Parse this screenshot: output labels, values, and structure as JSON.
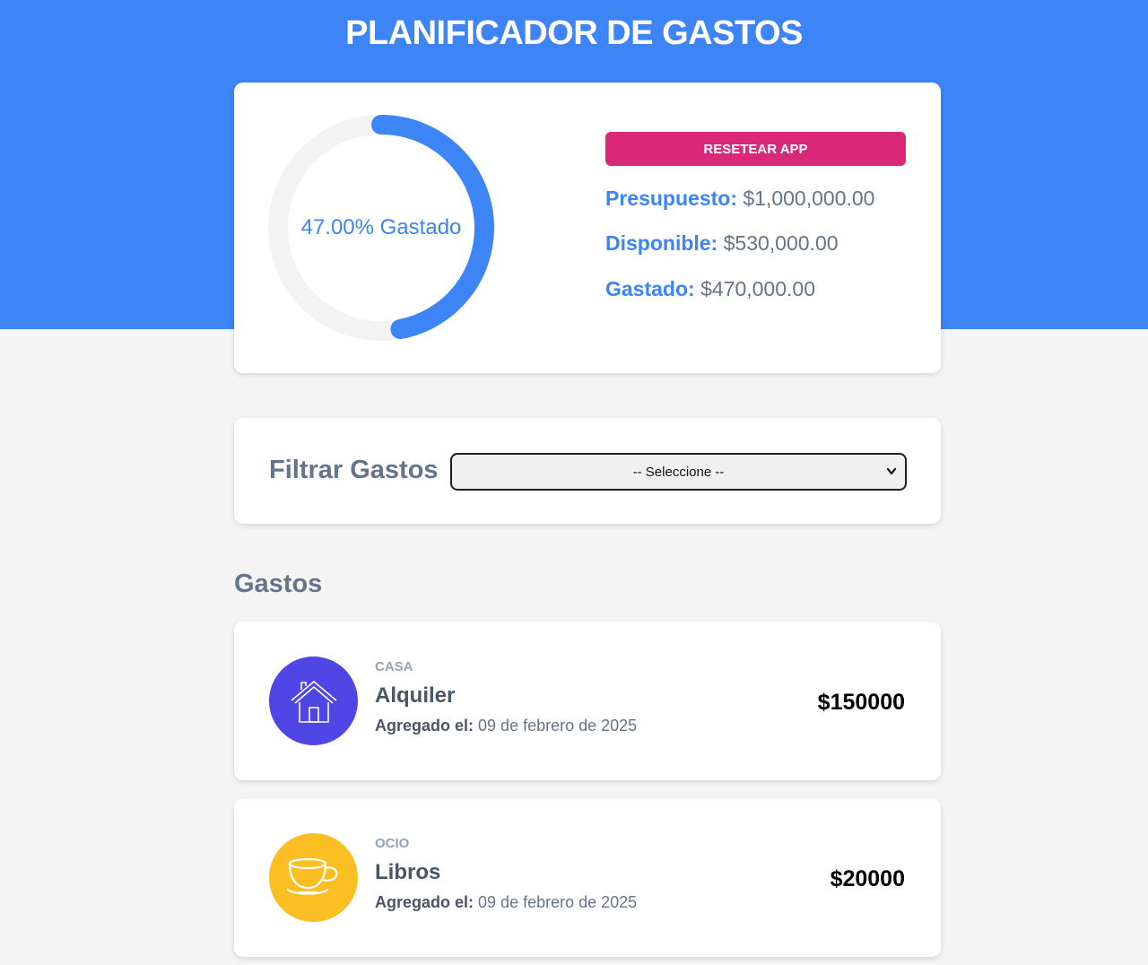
{
  "app": {
    "title": "PLANIFICADOR DE GASTOS"
  },
  "budget": {
    "progress_label": "47.00% Gastado",
    "progress_fraction": 0.47,
    "reset_label": "RESETEAR APP",
    "stats": [
      {
        "label": "Presupuesto:",
        "value": "$1,000,000.00"
      },
      {
        "label": "Disponible:",
        "value": "$530,000.00"
      },
      {
        "label": "Gastado:",
        "value": "$470,000.00"
      }
    ]
  },
  "filter": {
    "label": "Filtrar Gastos",
    "selected": "-- Seleccione --"
  },
  "expenses_section": {
    "title": "Gastos"
  },
  "expenses": [
    {
      "category": "CASA",
      "name": "Alquiler",
      "date_label": "Agregado el:",
      "date": "09 de febrero de 2025",
      "amount": "$150000",
      "icon": "house-icon",
      "icon_bg": "#4f46e5"
    },
    {
      "category": "OCIO",
      "name": "Libros",
      "date_label": "Agregado el:",
      "date": "09 de febrero de 2025",
      "amount": "$20000",
      "icon": "teacup-icon",
      "icon_bg": "#fbbf24"
    }
  ],
  "colors": {
    "primary": "#3d84f6",
    "danger": "#db2777",
    "track": "#f3f3f3",
    "background": "#f4f4f4"
  }
}
